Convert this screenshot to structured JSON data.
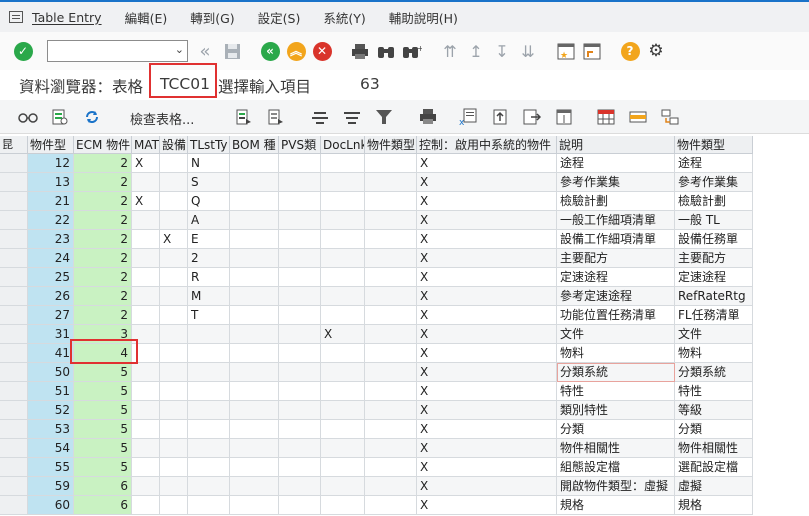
{
  "menu": {
    "items": [
      "Table Entry",
      "編輯(E)",
      "轉到(G)",
      "設定(S)",
      "系統(Y)",
      "輔助說明(H)"
    ]
  },
  "toolbar": {
    "command_value": "",
    "icons": [
      "check-icon",
      "back-double-icon",
      "save-icon",
      "back-icon",
      "exit-icon",
      "cancel-icon",
      "print-icon",
      "find-icon",
      "find-next-icon",
      "first-page-icon",
      "prev-page-icon",
      "next-page-icon",
      "last-page-icon",
      "new-session-icon",
      "shortcut-icon",
      "help-icon",
      "settings-icon"
    ]
  },
  "title": {
    "prefix": "資料瀏覽器：表格",
    "table": "TCC01",
    "suffix": "選擇輸入項目",
    "count": "63"
  },
  "app_toolbar": {
    "check_table_label": "檢查表格..."
  },
  "columns": [
    "物件型",
    "ECM 物件",
    "MAT",
    "設備",
    "TLstTy",
    "BOM 種",
    "PVS類",
    "DocLnk",
    "物件類型",
    "控制：啟用中系統的物件",
    "說明",
    "物件類型"
  ],
  "rows": [
    {
      "key": "12",
      "ecm": "2",
      "mat": "X",
      "equip": "",
      "tlst": "N",
      "bom": "",
      "pvs": "",
      "doc": "",
      "objtype": "",
      "ctrl": "X",
      "desc": "途程",
      "obj2": "途程"
    },
    {
      "key": "13",
      "ecm": "2",
      "mat": "",
      "equip": "",
      "tlst": "S",
      "bom": "",
      "pvs": "",
      "doc": "",
      "objtype": "",
      "ctrl": "X",
      "desc": "參考作業集",
      "obj2": "參考作業集"
    },
    {
      "key": "21",
      "ecm": "2",
      "mat": "X",
      "equip": "",
      "tlst": "Q",
      "bom": "",
      "pvs": "",
      "doc": "",
      "objtype": "",
      "ctrl": "X",
      "desc": "檢驗計劃",
      "obj2": "檢驗計劃"
    },
    {
      "key": "22",
      "ecm": "2",
      "mat": "",
      "equip": "",
      "tlst": "A",
      "bom": "",
      "pvs": "",
      "doc": "",
      "objtype": "",
      "ctrl": "X",
      "desc": "一般工作細項清單",
      "obj2": "一般 TL"
    },
    {
      "key": "23",
      "ecm": "2",
      "mat": "",
      "equip": "X",
      "tlst": "E",
      "bom": "",
      "pvs": "",
      "doc": "",
      "objtype": "",
      "ctrl": "X",
      "desc": "設備工作細項清單",
      "obj2": "設備任務單"
    },
    {
      "key": "24",
      "ecm": "2",
      "mat": "",
      "equip": "",
      "tlst": "2",
      "bom": "",
      "pvs": "",
      "doc": "",
      "objtype": "",
      "ctrl": "X",
      "desc": "主要配方",
      "obj2": "主要配方"
    },
    {
      "key": "25",
      "ecm": "2",
      "mat": "",
      "equip": "",
      "tlst": "R",
      "bom": "",
      "pvs": "",
      "doc": "",
      "objtype": "",
      "ctrl": "X",
      "desc": "定速途程",
      "obj2": "定速途程"
    },
    {
      "key": "26",
      "ecm": "2",
      "mat": "",
      "equip": "",
      "tlst": "M",
      "bom": "",
      "pvs": "",
      "doc": "",
      "objtype": "",
      "ctrl": "X",
      "desc": "參考定速途程",
      "obj2": "RefRateRtg"
    },
    {
      "key": "27",
      "ecm": "2",
      "mat": "",
      "equip": "",
      "tlst": "T",
      "bom": "",
      "pvs": "",
      "doc": "",
      "objtype": "",
      "ctrl": "X",
      "desc": "功能位置任務清單",
      "obj2": "FL任務清單"
    },
    {
      "key": "31",
      "ecm": "3",
      "mat": "",
      "equip": "",
      "tlst": "",
      "bom": "",
      "pvs": "",
      "doc": "X",
      "objtype": "",
      "ctrl": "X",
      "desc": "文件",
      "obj2": "文件"
    },
    {
      "key": "41",
      "ecm": "4",
      "mat": "",
      "equip": "",
      "tlst": "",
      "bom": "",
      "pvs": "",
      "doc": "",
      "objtype": "",
      "ctrl": "X",
      "desc": "物料",
      "obj2": "物料"
    },
    {
      "key": "50",
      "ecm": "5",
      "mat": "",
      "equip": "",
      "tlst": "",
      "bom": "",
      "pvs": "",
      "doc": "",
      "objtype": "",
      "ctrl": "X",
      "desc": "分類系統",
      "obj2": "分類系統"
    },
    {
      "key": "51",
      "ecm": "5",
      "mat": "",
      "equip": "",
      "tlst": "",
      "bom": "",
      "pvs": "",
      "doc": "",
      "objtype": "",
      "ctrl": "X",
      "desc": "特性",
      "obj2": "特性"
    },
    {
      "key": "52",
      "ecm": "5",
      "mat": "",
      "equip": "",
      "tlst": "",
      "bom": "",
      "pvs": "",
      "doc": "",
      "objtype": "",
      "ctrl": "X",
      "desc": "類別特性",
      "obj2": "等級"
    },
    {
      "key": "53",
      "ecm": "5",
      "mat": "",
      "equip": "",
      "tlst": "",
      "bom": "",
      "pvs": "",
      "doc": "",
      "objtype": "",
      "ctrl": "X",
      "desc": "分類",
      "obj2": "分類"
    },
    {
      "key": "54",
      "ecm": "5",
      "mat": "",
      "equip": "",
      "tlst": "",
      "bom": "",
      "pvs": "",
      "doc": "",
      "objtype": "",
      "ctrl": "X",
      "desc": "物件相關性",
      "obj2": "物件相關性"
    },
    {
      "key": "55",
      "ecm": "5",
      "mat": "",
      "equip": "",
      "tlst": "",
      "bom": "",
      "pvs": "",
      "doc": "",
      "objtype": "",
      "ctrl": "X",
      "desc": "組態設定檔",
      "obj2": "選配設定檔"
    },
    {
      "key": "59",
      "ecm": "6",
      "mat": "",
      "equip": "",
      "tlst": "",
      "bom": "",
      "pvs": "",
      "doc": "",
      "objtype": "",
      "ctrl": "X",
      "desc": "開啟物件類型：虛擬",
      "obj2": "虛擬"
    },
    {
      "key": "60",
      "ecm": "6",
      "mat": "",
      "equip": "",
      "tlst": "",
      "bom": "",
      "pvs": "",
      "doc": "",
      "objtype": "",
      "ctrl": "X",
      "desc": "規格",
      "obj2": "規格"
    }
  ],
  "colors": {
    "key_column": "#bfe3f1",
    "ecm_column": "#c9f2c2",
    "highlight": "#e03131",
    "accent": "#1a73c9"
  }
}
